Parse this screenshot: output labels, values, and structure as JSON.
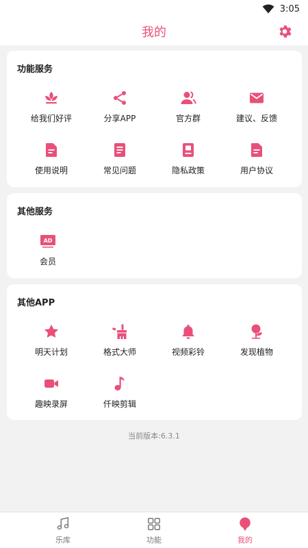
{
  "status_bar": {
    "time": "3:05"
  },
  "header": {
    "title": "我的"
  },
  "sections": [
    {
      "title": "功能服务",
      "items": [
        {
          "label": "给我们好评",
          "icon": "flower-icon"
        },
        {
          "label": "分享APP",
          "icon": "share-icon"
        },
        {
          "label": "官方群",
          "icon": "group-icon"
        },
        {
          "label": "建议、反馈",
          "icon": "mail-icon"
        },
        {
          "label": "使用说明",
          "icon": "document-icon"
        },
        {
          "label": "常见问题",
          "icon": "faq-icon"
        },
        {
          "label": "隐私政策",
          "icon": "privacy-icon"
        },
        {
          "label": "用户协议",
          "icon": "agreement-icon"
        }
      ]
    },
    {
      "title": "其他服务",
      "items": [
        {
          "label": "会员",
          "icon": "ad-icon",
          "badge": "AD"
        }
      ]
    },
    {
      "title": "其他APP",
      "items": [
        {
          "label": "明天计划",
          "icon": "star-icon"
        },
        {
          "label": "格式大师",
          "icon": "broom-icon"
        },
        {
          "label": "视频彩铃",
          "icon": "bell-icon"
        },
        {
          "label": "发现植物",
          "icon": "plant-icon"
        },
        {
          "label": "趣映录屏",
          "icon": "video-camera-icon"
        },
        {
          "label": "仟映剪辑",
          "icon": "music-note-icon"
        }
      ]
    }
  ],
  "version": {
    "text": "当前版本:6.3.1"
  },
  "bottom_nav": [
    {
      "label": "乐库",
      "icon": "music-library-icon",
      "active": false
    },
    {
      "label": "功能",
      "icon": "grid-icon",
      "active": false
    },
    {
      "label": "我的",
      "icon": "profile-icon",
      "active": true
    }
  ],
  "colors": {
    "accent": "#e8507a",
    "background": "#f2f2f2",
    "card": "#ffffff",
    "inactive": "#777777"
  }
}
